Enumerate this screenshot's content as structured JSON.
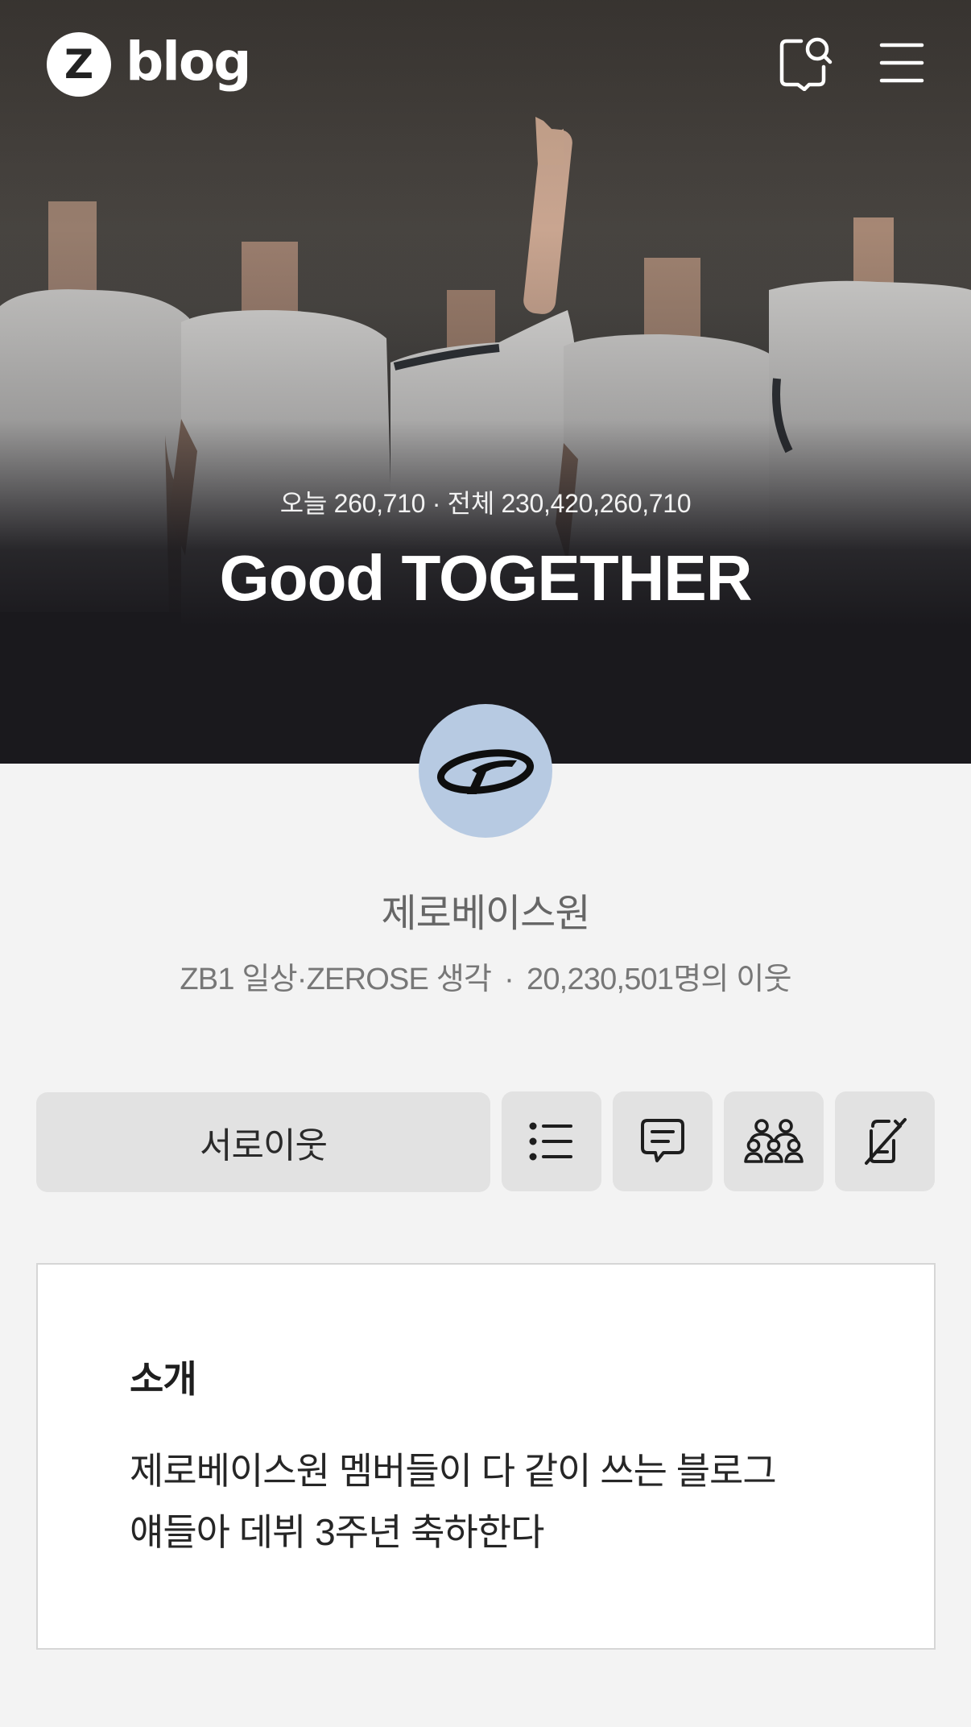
{
  "header": {
    "logo_mark": "Z",
    "logo_text": "blog",
    "icons": {
      "search": "search-chat-icon",
      "menu": "hamburger-menu-icon"
    }
  },
  "hero": {
    "visitor_counter": "오늘 260,710 · 전체 230,420,260,710",
    "blog_title": "Good TOGETHER"
  },
  "profile": {
    "name": "제로베이스원",
    "category": "ZB1 일상·ZEROSE 생각",
    "separator": "·",
    "neighbors": "20,230,501명의 이웃"
  },
  "actions": {
    "neighbor_button_label": "서로이웃",
    "icons": [
      "list-icon",
      "comment-icon",
      "people-icon",
      "mute-phone-icon"
    ]
  },
  "intro": {
    "title": "소개",
    "lines": [
      "제로베이스원 멤버들이 다 같이 쓰는 블로그",
      "얘들아 데뷔 3주년 축하한다"
    ]
  },
  "colors": {
    "page_background": "#f3f3f3",
    "hero_dark": "#1a191d",
    "avatar_background": "#b7cae2",
    "button_background": "#e2e2e2"
  }
}
